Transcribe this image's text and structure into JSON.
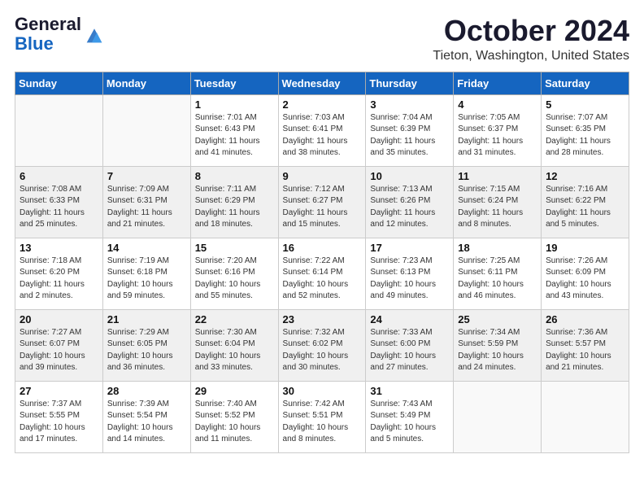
{
  "header": {
    "logo_general": "General",
    "logo_blue": "Blue",
    "month_title": "October 2024",
    "location": "Tieton, Washington, United States"
  },
  "weekdays": [
    "Sunday",
    "Monday",
    "Tuesday",
    "Wednesday",
    "Thursday",
    "Friday",
    "Saturday"
  ],
  "weeks": [
    [
      {
        "day": "",
        "info": ""
      },
      {
        "day": "",
        "info": ""
      },
      {
        "day": "1",
        "info": "Sunrise: 7:01 AM\nSunset: 6:43 PM\nDaylight: 11 hours and 41 minutes."
      },
      {
        "day": "2",
        "info": "Sunrise: 7:03 AM\nSunset: 6:41 PM\nDaylight: 11 hours and 38 minutes."
      },
      {
        "day": "3",
        "info": "Sunrise: 7:04 AM\nSunset: 6:39 PM\nDaylight: 11 hours and 35 minutes."
      },
      {
        "day": "4",
        "info": "Sunrise: 7:05 AM\nSunset: 6:37 PM\nDaylight: 11 hours and 31 minutes."
      },
      {
        "day": "5",
        "info": "Sunrise: 7:07 AM\nSunset: 6:35 PM\nDaylight: 11 hours and 28 minutes."
      }
    ],
    [
      {
        "day": "6",
        "info": "Sunrise: 7:08 AM\nSunset: 6:33 PM\nDaylight: 11 hours and 25 minutes."
      },
      {
        "day": "7",
        "info": "Sunrise: 7:09 AM\nSunset: 6:31 PM\nDaylight: 11 hours and 21 minutes."
      },
      {
        "day": "8",
        "info": "Sunrise: 7:11 AM\nSunset: 6:29 PM\nDaylight: 11 hours and 18 minutes."
      },
      {
        "day": "9",
        "info": "Sunrise: 7:12 AM\nSunset: 6:27 PM\nDaylight: 11 hours and 15 minutes."
      },
      {
        "day": "10",
        "info": "Sunrise: 7:13 AM\nSunset: 6:26 PM\nDaylight: 11 hours and 12 minutes."
      },
      {
        "day": "11",
        "info": "Sunrise: 7:15 AM\nSunset: 6:24 PM\nDaylight: 11 hours and 8 minutes."
      },
      {
        "day": "12",
        "info": "Sunrise: 7:16 AM\nSunset: 6:22 PM\nDaylight: 11 hours and 5 minutes."
      }
    ],
    [
      {
        "day": "13",
        "info": "Sunrise: 7:18 AM\nSunset: 6:20 PM\nDaylight: 11 hours and 2 minutes."
      },
      {
        "day": "14",
        "info": "Sunrise: 7:19 AM\nSunset: 6:18 PM\nDaylight: 10 hours and 59 minutes."
      },
      {
        "day": "15",
        "info": "Sunrise: 7:20 AM\nSunset: 6:16 PM\nDaylight: 10 hours and 55 minutes."
      },
      {
        "day": "16",
        "info": "Sunrise: 7:22 AM\nSunset: 6:14 PM\nDaylight: 10 hours and 52 minutes."
      },
      {
        "day": "17",
        "info": "Sunrise: 7:23 AM\nSunset: 6:13 PM\nDaylight: 10 hours and 49 minutes."
      },
      {
        "day": "18",
        "info": "Sunrise: 7:25 AM\nSunset: 6:11 PM\nDaylight: 10 hours and 46 minutes."
      },
      {
        "day": "19",
        "info": "Sunrise: 7:26 AM\nSunset: 6:09 PM\nDaylight: 10 hours and 43 minutes."
      }
    ],
    [
      {
        "day": "20",
        "info": "Sunrise: 7:27 AM\nSunset: 6:07 PM\nDaylight: 10 hours and 39 minutes."
      },
      {
        "day": "21",
        "info": "Sunrise: 7:29 AM\nSunset: 6:05 PM\nDaylight: 10 hours and 36 minutes."
      },
      {
        "day": "22",
        "info": "Sunrise: 7:30 AM\nSunset: 6:04 PM\nDaylight: 10 hours and 33 minutes."
      },
      {
        "day": "23",
        "info": "Sunrise: 7:32 AM\nSunset: 6:02 PM\nDaylight: 10 hours and 30 minutes."
      },
      {
        "day": "24",
        "info": "Sunrise: 7:33 AM\nSunset: 6:00 PM\nDaylight: 10 hours and 27 minutes."
      },
      {
        "day": "25",
        "info": "Sunrise: 7:34 AM\nSunset: 5:59 PM\nDaylight: 10 hours and 24 minutes."
      },
      {
        "day": "26",
        "info": "Sunrise: 7:36 AM\nSunset: 5:57 PM\nDaylight: 10 hours and 21 minutes."
      }
    ],
    [
      {
        "day": "27",
        "info": "Sunrise: 7:37 AM\nSunset: 5:55 PM\nDaylight: 10 hours and 17 minutes."
      },
      {
        "day": "28",
        "info": "Sunrise: 7:39 AM\nSunset: 5:54 PM\nDaylight: 10 hours and 14 minutes."
      },
      {
        "day": "29",
        "info": "Sunrise: 7:40 AM\nSunset: 5:52 PM\nDaylight: 10 hours and 11 minutes."
      },
      {
        "day": "30",
        "info": "Sunrise: 7:42 AM\nSunset: 5:51 PM\nDaylight: 10 hours and 8 minutes."
      },
      {
        "day": "31",
        "info": "Sunrise: 7:43 AM\nSunset: 5:49 PM\nDaylight: 10 hours and 5 minutes."
      },
      {
        "day": "",
        "info": ""
      },
      {
        "day": "",
        "info": ""
      }
    ]
  ]
}
